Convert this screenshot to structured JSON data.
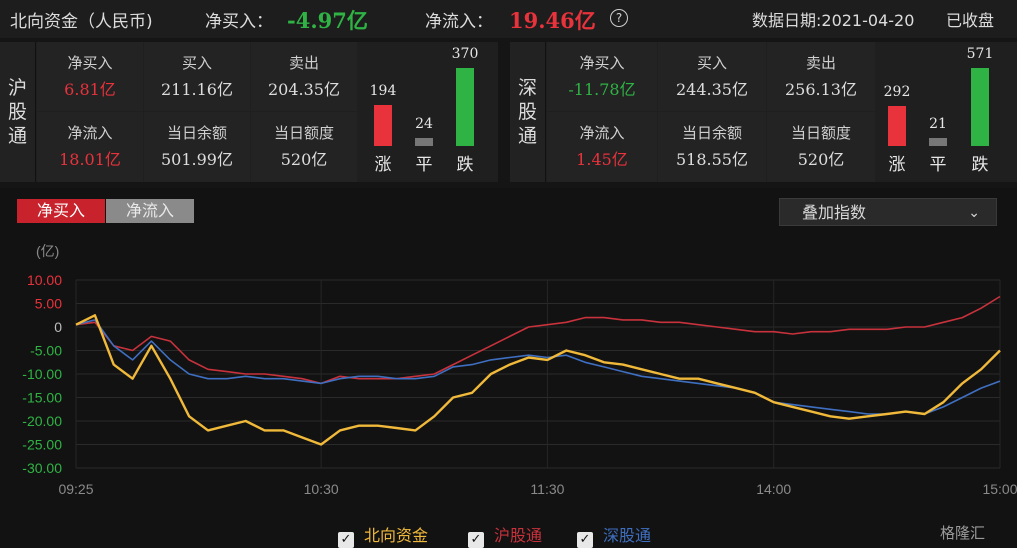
{
  "header": {
    "title": "北向资金（人民币)",
    "net_buy_label": "净买入：",
    "net_buy_value": "-4.97亿",
    "net_flow_label": "净流入：",
    "net_flow_value": "19.46亿",
    "help_icon": "?",
    "date_label": "数据日期:2021-04-20",
    "status": "已收盘"
  },
  "hu": {
    "name": "沪股通",
    "net_buy_label": "净买入",
    "net_buy_value": "6.81亿",
    "buy_label": "买入",
    "buy_value": "211.16亿",
    "sell_label": "卖出",
    "sell_value": "204.35亿",
    "net_flow_label": "净流入",
    "net_flow_value": "18.01亿",
    "balance_label": "当日余额",
    "balance_value": "501.99亿",
    "quota_label": "当日额度",
    "quota_value": "520亿",
    "up": 194,
    "flat": 24,
    "down": 370,
    "up_label": "涨",
    "flat_label": "平",
    "down_label": "跌"
  },
  "shen": {
    "name": "深股通",
    "net_buy_label": "净买入",
    "net_buy_value": "-11.78亿",
    "buy_label": "买入",
    "buy_value": "244.35亿",
    "sell_label": "卖出",
    "sell_value": "256.13亿",
    "net_flow_label": "净流入",
    "net_flow_value": "1.45亿",
    "balance_label": "当日余额",
    "balance_value": "518.55亿",
    "quota_label": "当日额度",
    "quota_value": "520亿",
    "up": 292,
    "flat": 21,
    "down": 571,
    "up_label": "涨",
    "flat_label": "平",
    "down_label": "跌"
  },
  "tabs": {
    "net_buy": "净买入",
    "net_flow": "净流入"
  },
  "overlay_select": {
    "label": "叠加指数"
  },
  "colors": {
    "north": "#f0b93a",
    "hu": "#c8323c",
    "shen": "#3f6fc0",
    "up": "#e8323c",
    "down": "#2fb344",
    "flat": "#777777"
  },
  "legend": {
    "north": "北向资金",
    "hu": "沪股通",
    "shen": "深股通"
  },
  "logo": "格隆汇",
  "chart_data": {
    "type": "line",
    "ylabel": "(亿)",
    "ylim": [
      -30,
      10
    ],
    "yticks": [
      "10.00",
      "5.00",
      "0",
      "-5.00",
      "-10.00",
      "-15.00",
      "-20.00",
      "-25.00",
      "-30.00"
    ],
    "xticks": [
      "09:25",
      "10:30",
      "11:30",
      "14:00",
      "15:00"
    ],
    "grid": true,
    "x": [
      "09:25",
      "09:30",
      "09:35",
      "09:40",
      "09:45",
      "09:50",
      "09:55",
      "10:00",
      "10:05",
      "10:10",
      "10:15",
      "10:20",
      "10:25",
      "10:30",
      "10:35",
      "10:40",
      "10:45",
      "10:50",
      "10:55",
      "11:00",
      "11:05",
      "11:10",
      "11:15",
      "11:20",
      "11:25",
      "11:30",
      "13:05",
      "13:10",
      "13:15",
      "13:20",
      "13:25",
      "13:30",
      "13:35",
      "13:40",
      "13:45",
      "13:50",
      "13:55",
      "14:00",
      "14:05",
      "14:10",
      "14:15",
      "14:20",
      "14:25",
      "14:30",
      "14:35",
      "14:40",
      "14:45",
      "14:50",
      "14:55",
      "15:00"
    ],
    "series": [
      {
        "name": "北向资金",
        "values": [
          0.5,
          2.5,
          -8,
          -11,
          -4,
          -11,
          -19,
          -22,
          -21,
          -20,
          -22,
          -22,
          -23.5,
          -25,
          -22,
          -21,
          -21,
          -21.5,
          -22,
          -19,
          -15,
          -14,
          -10,
          -8,
          -6.5,
          -7,
          -5,
          -6,
          -7.5,
          -8,
          -9,
          -10,
          -11,
          -11,
          -12,
          -13,
          -14,
          -16,
          -17,
          -18,
          -19,
          -19.5,
          -19,
          -18.5,
          -18,
          -18.5,
          -16,
          -12,
          -9,
          -5
        ]
      },
      {
        "name": "沪股通",
        "values": [
          0.5,
          1,
          -4,
          -5,
          -2,
          -3,
          -7,
          -9,
          -9.5,
          -10,
          -10,
          -10.5,
          -11,
          -12,
          -10.5,
          -11,
          -11,
          -11,
          -10.5,
          -10,
          -8,
          -6,
          -4,
          -2,
          0,
          0.5,
          1,
          2,
          2,
          1.5,
          1.5,
          1,
          1,
          0.5,
          0,
          -0.5,
          -1,
          -1,
          -1.5,
          -1,
          -1,
          -0.5,
          -0.5,
          -0.5,
          0,
          0,
          1,
          2,
          4,
          6.5
        ]
      },
      {
        "name": "深股通",
        "values": [
          0.5,
          1.5,
          -4,
          -7,
          -3,
          -7,
          -10,
          -11,
          -11,
          -10.5,
          -11,
          -11,
          -11.5,
          -12,
          -11,
          -10.5,
          -10.5,
          -11,
          -11,
          -10.5,
          -8.5,
          -8,
          -7,
          -6.5,
          -6,
          -6.5,
          -6,
          -7.5,
          -8.5,
          -9.5,
          -10.5,
          -11,
          -11.5,
          -12,
          -12.5,
          -13,
          -14,
          -16,
          -16.5,
          -17,
          -17.5,
          -18,
          -18.5,
          -18.5,
          -18,
          -18.5,
          -17,
          -15,
          -13,
          -11.5
        ]
      }
    ]
  }
}
